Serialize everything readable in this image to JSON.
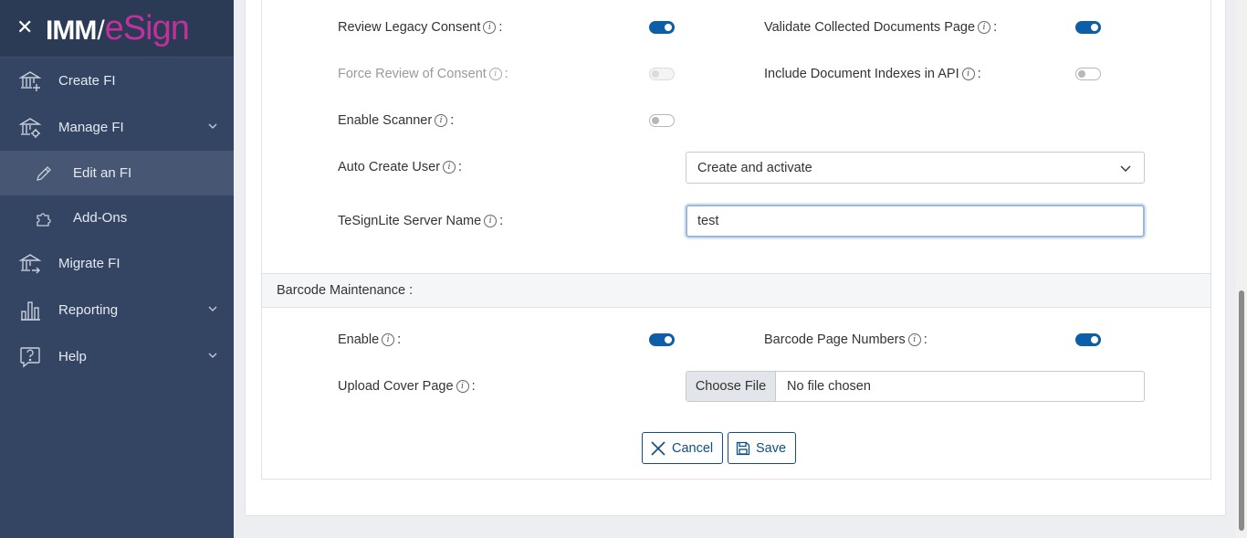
{
  "sidebar": {
    "logo": {
      "part1": "IMM",
      "part2": "/",
      "part3": "eSign"
    },
    "items": [
      {
        "label": "Create FI",
        "icon": "bank-plus-icon"
      },
      {
        "label": "Manage FI",
        "icon": "bank-gear-icon"
      },
      {
        "label": "Edit an FI",
        "icon": "pencil-icon"
      },
      {
        "label": "Add-Ons",
        "icon": "puzzle-icon"
      },
      {
        "label": "Migrate FI",
        "icon": "bank-arrow-icon"
      },
      {
        "label": "Reporting",
        "icon": "bar-chart-icon"
      },
      {
        "label": "Help",
        "icon": "help-bubble-icon"
      }
    ]
  },
  "form": {
    "review_legacy_consent": {
      "label": "Review Legacy Consent",
      "enabled": true
    },
    "validate_collected_documents": {
      "label": "Validate Collected Documents Page",
      "enabled": true
    },
    "force_review_consent": {
      "label": "Force Review of Consent",
      "enabled": false,
      "disabled": true
    },
    "include_document_indexes": {
      "label": "Include Document Indexes in API",
      "enabled": false
    },
    "enable_scanner": {
      "label": "Enable Scanner",
      "enabled": false
    },
    "auto_create_user": {
      "label": "Auto Create User",
      "value": "Create and activate"
    },
    "tesignlite_server": {
      "label": "TeSignLite Server Name",
      "value": "test"
    },
    "barcode_section": {
      "title": "Barcode Maintenance :"
    },
    "barcode_enable": {
      "label": "Enable",
      "enabled": true
    },
    "barcode_page_numbers": {
      "label": "Barcode Page Numbers",
      "enabled": true
    },
    "upload_cover_page": {
      "label": "Upload Cover Page",
      "button": "Choose File",
      "file_status": "No file chosen"
    },
    "info_glyph": "i",
    "colon": ":"
  },
  "actions": {
    "cancel": "Cancel",
    "save": "Save"
  },
  "colors": {
    "primary": "#0d5ea8",
    "sidebar": "#344563",
    "brand": "#c0329a"
  }
}
